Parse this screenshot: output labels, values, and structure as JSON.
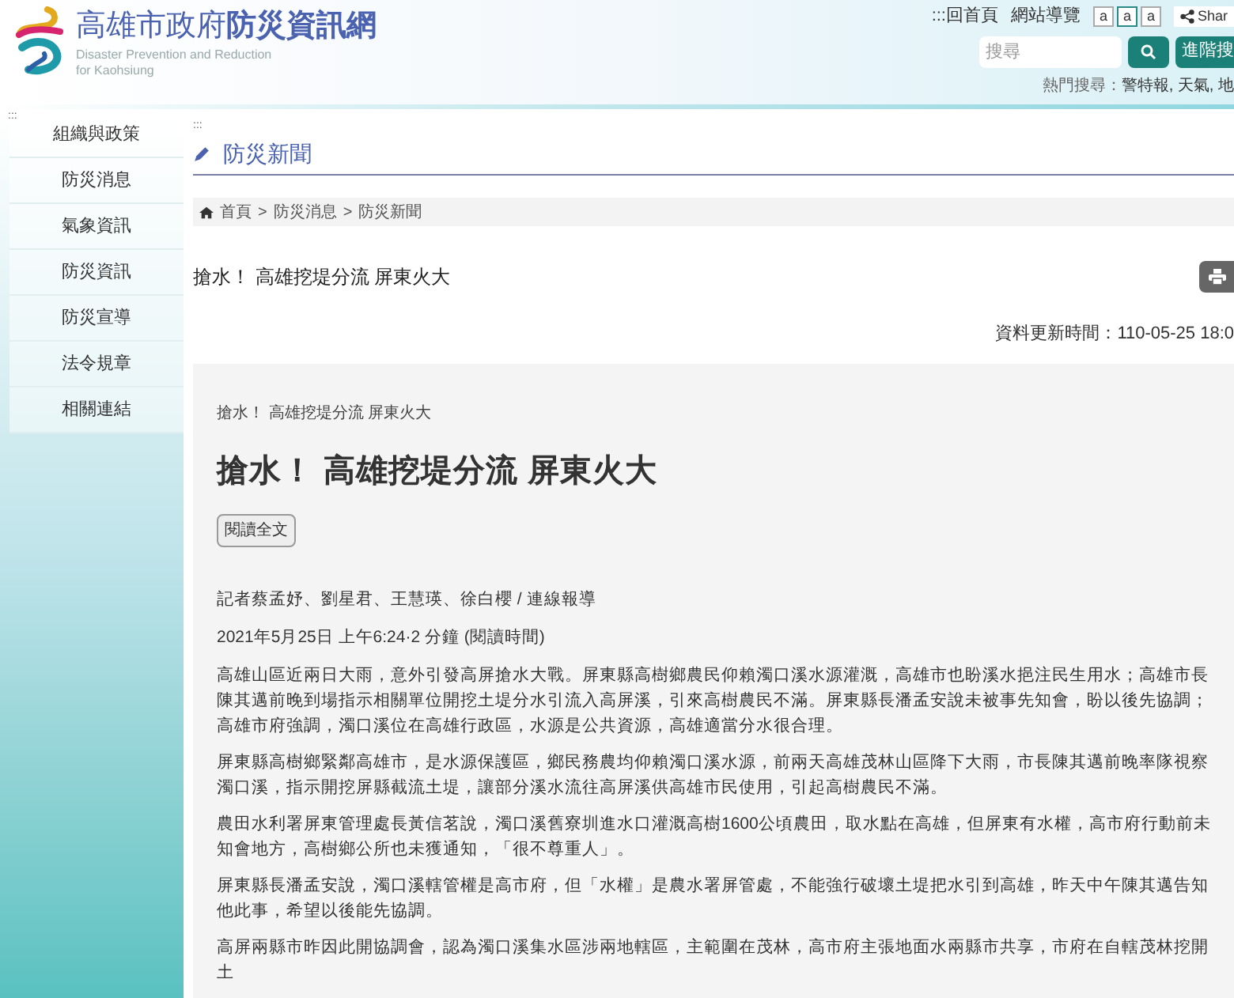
{
  "header": {
    "logo_title_regular": "高雄市政府",
    "logo_title_bold": "防災資訊網",
    "logo_subtitle_line1": "Disaster Prevention and Reduction",
    "logo_subtitle_line2": "for Kaohsiung",
    "top_links": [
      ":::回首頁",
      "網站導覽"
    ],
    "font_sizes": [
      {
        "label": "a",
        "selected": false
      },
      {
        "label": "a",
        "selected": true
      },
      {
        "label": "a",
        "selected": false
      }
    ],
    "share": "Shar",
    "search": {
      "placeholder": "搜尋"
    },
    "advanced_search": "進階搜",
    "hot_search_label": "熱門搜尋：",
    "hot_search_terms": "警特報, 天氣, 地"
  },
  "sidebar": {
    "marker": ":::",
    "items": [
      {
        "label": "組織與政策"
      },
      {
        "label": "防災消息"
      },
      {
        "label": "氣象資訊"
      },
      {
        "label": "防災資訊"
      },
      {
        "label": "防災宣導"
      },
      {
        "label": "法令規章"
      },
      {
        "label": "相關連結"
      }
    ]
  },
  "main": {
    "marker": ":::",
    "section_title": "防災新聞",
    "breadcrumb": [
      {
        "label": "首頁"
      },
      {
        "separator": ">",
        "label": "防災消息"
      },
      {
        "separator": ">",
        "label": "防災新聞"
      }
    ],
    "page_title": "搶水！ 高雄挖堤分流 屏東火大",
    "updated": "資料更新時間：110-05-25 18:0",
    "article": {
      "kicker": "搶水！ 高雄挖堤分流 屏東火大",
      "title": "搶水！ 高雄挖堤分流 屏東火大",
      "read_button": "閱讀全文",
      "byline": "記者蔡孟妤、劉星君、王慧瑛、徐白櫻 / 連線報導",
      "dateline": "2021年5月25日 上午6:24·2 分鐘 (閱讀時間)",
      "paragraphs": [
        "高雄山區近兩日大雨，意外引發高屏搶水大戰。屏東縣高樹鄉農民仰賴濁口溪水源灌溉，高雄市也盼溪水挹注民生用水；高雄市長陳其邁前晚到場指示相關單位開挖土堤分水引流入高屏溪，引來高樹農民不滿。屏東縣長潘孟安說未被事先知會，盼以後先協調；高雄市府強調，濁口溪位在高雄行政區，水源是公共資源，高雄適當分水很合理。",
        "屏東縣高樹鄉緊鄰高雄市，是水源保護區，鄉民務農均仰賴濁口溪水源，前兩天高雄茂林山區降下大雨，市長陳其邁前晚率隊視察濁口溪，指示開挖屏縣截流土堤，讓部分溪水流往高屏溪供高雄市民使用，引起高樹農民不滿。",
        "農田水利署屏東管理處長黃信茗說，濁口溪舊寮圳進水口灌溉高樹1600公頃農田，取水點在高雄，但屏東有水權，高市府行動前未知會地方，高樹鄉公所也未獲通知，「很不尊重人」。",
        "屏東縣長潘孟安說，濁口溪轄管權是高市府，但「水權」是農水署屏管處，不能強行破壞土堤把水引到高雄，昨天中午陳其邁告知他此事，希望以後能先協調。",
        "高屏兩縣市昨因此開協調會，認為濁口溪集水區涉兩地轄區，主範圍在茂林，高市府主張地面水兩縣市共享，市府在自轄茂林挖開土"
      ]
    }
  }
}
